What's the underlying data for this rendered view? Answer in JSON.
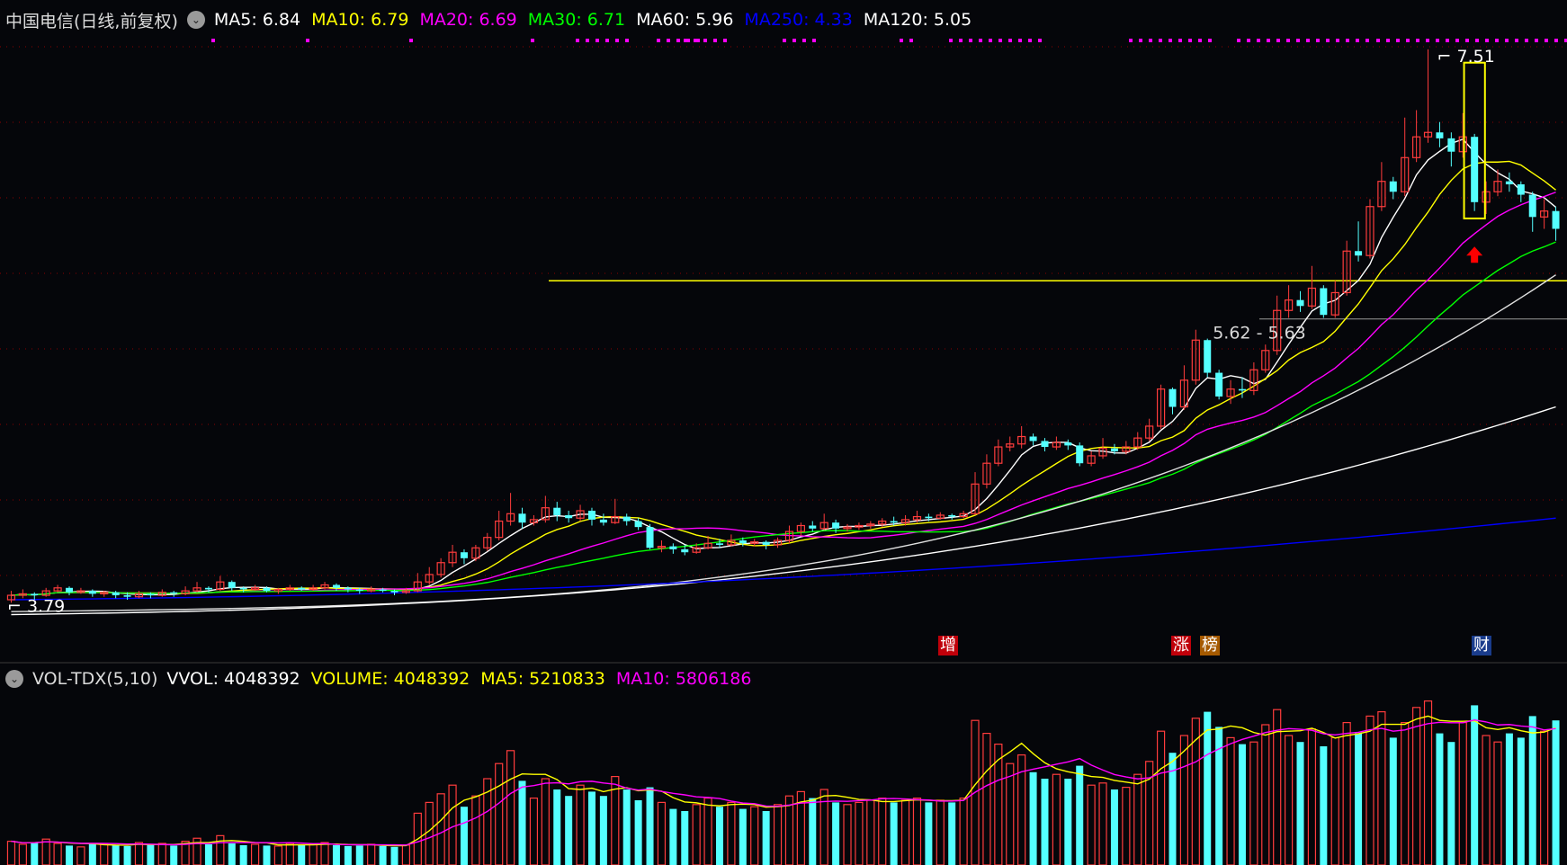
{
  "header": {
    "title": "中国电信(日线,前复权)",
    "ma": [
      {
        "label": "MA5: 6.84",
        "color": "#ffffff"
      },
      {
        "label": "MA10: 6.79",
        "color": "#ffff00"
      },
      {
        "label": "MA20: 6.69",
        "color": "#ff00ff"
      },
      {
        "label": "MA30: 6.71",
        "color": "#00ff00"
      },
      {
        "label": "MA60: 5.96",
        "color": "#ffffff"
      },
      {
        "label": "MA250: 4.33",
        "color": "#0000ff"
      },
      {
        "label": "MA120: 5.05",
        "color": "#ffffff"
      }
    ]
  },
  "volume_header": {
    "title": "VOL-TDX(5,10)",
    "items": [
      {
        "label": "VVOL: 4048392",
        "color": "#ffffff"
      },
      {
        "label": "VOLUME: 4048392",
        "color": "#ffff00"
      },
      {
        "label": "MA5: 5210833",
        "color": "#ffff00"
      },
      {
        "label": "MA10: 5806186",
        "color": "#ff00ff"
      }
    ]
  },
  "annotations": {
    "high_label": "7.51",
    "low_label": "3.79",
    "gap_label": "5.62 - 5.63",
    "event_tags": [
      {
        "text": "增",
        "bg": "#c0000a"
      },
      {
        "text": "涨",
        "bg": "#c0000a"
      },
      {
        "text": "榜",
        "bg": "#a65a00"
      },
      {
        "text": "财",
        "bg": "#1a3c8c"
      }
    ]
  },
  "colors": {
    "up": "#ff3c3c",
    "down": "#54ffff",
    "background": "#05060a",
    "grid": "#8a0000",
    "ma5": "#ffffff",
    "ma10": "#ffff00",
    "ma20": "#ff00ff",
    "ma30": "#00ff00",
    "ma60": "#e0e0e0",
    "ma120": "#ffffff",
    "ma250": "#0000ff",
    "support_line": "#ffff00",
    "highlight_box": "#ffff00",
    "arrow": "#ff0000",
    "dots": "#ff00ff"
  },
  "chart_data": {
    "type": "candlestick",
    "ylim": [
      3.6,
      7.6
    ],
    "support_level": 5.95,
    "gap_level": 5.62,
    "candles": [
      [
        3.8,
        3.83,
        3.86,
        3.78
      ],
      [
        3.83,
        3.84,
        3.87,
        3.81
      ],
      [
        3.84,
        3.83,
        3.85,
        3.8
      ],
      [
        3.83,
        3.86,
        3.88,
        3.82
      ],
      [
        3.86,
        3.88,
        3.9,
        3.85
      ],
      [
        3.88,
        3.85,
        3.89,
        3.83
      ],
      [
        3.85,
        3.86,
        3.88,
        3.84
      ],
      [
        3.86,
        3.84,
        3.87,
        3.82
      ],
      [
        3.84,
        3.85,
        3.86,
        3.82
      ],
      [
        3.85,
        3.83,
        3.86,
        3.81
      ],
      [
        3.83,
        3.82,
        3.85,
        3.8
      ],
      [
        3.82,
        3.84,
        3.86,
        3.81
      ],
      [
        3.84,
        3.83,
        3.85,
        3.81
      ],
      [
        3.83,
        3.85,
        3.87,
        3.82
      ],
      [
        3.85,
        3.84,
        3.86,
        3.82
      ],
      [
        3.84,
        3.86,
        3.89,
        3.83
      ],
      [
        3.86,
        3.88,
        3.92,
        3.85
      ],
      [
        3.88,
        3.87,
        3.89,
        3.85
      ],
      [
        3.87,
        3.92,
        3.96,
        3.86
      ],
      [
        3.92,
        3.88,
        3.93,
        3.86
      ],
      [
        3.88,
        3.87,
        3.89,
        3.85
      ],
      [
        3.87,
        3.88,
        3.9,
        3.86
      ],
      [
        3.88,
        3.86,
        3.89,
        3.85
      ],
      [
        3.86,
        3.87,
        3.88,
        3.84
      ],
      [
        3.87,
        3.88,
        3.9,
        3.86
      ],
      [
        3.88,
        3.87,
        3.89,
        3.86
      ],
      [
        3.87,
        3.88,
        3.9,
        3.86
      ],
      [
        3.88,
        3.9,
        3.92,
        3.87
      ],
      [
        3.9,
        3.88,
        3.91,
        3.86
      ],
      [
        3.88,
        3.87,
        3.89,
        3.85
      ],
      [
        3.87,
        3.86,
        3.88,
        3.84
      ],
      [
        3.86,
        3.87,
        3.89,
        3.85
      ],
      [
        3.87,
        3.86,
        3.88,
        3.85
      ],
      [
        3.86,
        3.85,
        3.87,
        3.83
      ],
      [
        3.85,
        3.86,
        3.88,
        3.84
      ],
      [
        3.86,
        3.92,
        3.98,
        3.85
      ],
      [
        3.92,
        3.97,
        4.02,
        3.9
      ],
      [
        3.97,
        4.05,
        4.08,
        3.95
      ],
      [
        4.05,
        4.12,
        4.17,
        4.02
      ],
      [
        4.12,
        4.08,
        4.14,
        4.04
      ],
      [
        4.08,
        4.15,
        4.17,
        4.06
      ],
      [
        4.15,
        4.22,
        4.25,
        4.13
      ],
      [
        4.22,
        4.33,
        4.4,
        4.2
      ],
      [
        4.33,
        4.38,
        4.52,
        4.3
      ],
      [
        4.38,
        4.32,
        4.42,
        4.28
      ],
      [
        4.32,
        4.34,
        4.37,
        4.3
      ],
      [
        4.34,
        4.42,
        4.5,
        4.32
      ],
      [
        4.42,
        4.37,
        4.46,
        4.33
      ],
      [
        4.37,
        4.35,
        4.4,
        4.32
      ],
      [
        4.35,
        4.4,
        4.44,
        4.33
      ],
      [
        4.4,
        4.34,
        4.42,
        4.3
      ],
      [
        4.34,
        4.32,
        4.38,
        4.3
      ],
      [
        4.32,
        4.36,
        4.48,
        4.31
      ],
      [
        4.36,
        4.33,
        4.38,
        4.3
      ],
      [
        4.33,
        4.29,
        4.35,
        4.27
      ],
      [
        4.29,
        4.15,
        4.31,
        4.14
      ],
      [
        4.15,
        4.16,
        4.2,
        4.12
      ],
      [
        4.16,
        4.14,
        4.18,
        4.11
      ],
      [
        4.14,
        4.12,
        4.17,
        4.1
      ],
      [
        4.12,
        4.15,
        4.18,
        4.11
      ],
      [
        4.15,
        4.18,
        4.23,
        4.14
      ],
      [
        4.18,
        4.17,
        4.21,
        4.15
      ],
      [
        4.17,
        4.2,
        4.24,
        4.16
      ],
      [
        4.2,
        4.18,
        4.22,
        4.16
      ],
      [
        4.18,
        4.19,
        4.21,
        4.16
      ],
      [
        4.19,
        4.17,
        4.2,
        4.14
      ],
      [
        4.17,
        4.2,
        4.22,
        4.15
      ],
      [
        4.2,
        4.26,
        4.3,
        4.18
      ],
      [
        4.26,
        4.3,
        4.32,
        4.23
      ],
      [
        4.3,
        4.28,
        4.33,
        4.26
      ],
      [
        4.28,
        4.32,
        4.38,
        4.27
      ],
      [
        4.32,
        4.28,
        4.34,
        4.25
      ],
      [
        4.28,
        4.29,
        4.31,
        4.26
      ],
      [
        4.29,
        4.3,
        4.32,
        4.27
      ],
      [
        4.3,
        4.31,
        4.33,
        4.28
      ],
      [
        4.31,
        4.33,
        4.35,
        4.29
      ],
      [
        4.33,
        4.32,
        4.36,
        4.3
      ],
      [
        4.32,
        4.34,
        4.37,
        4.3
      ],
      [
        4.34,
        4.36,
        4.4,
        4.32
      ],
      [
        4.36,
        4.35,
        4.38,
        4.33
      ],
      [
        4.35,
        4.37,
        4.39,
        4.34
      ],
      [
        4.37,
        4.36,
        4.38,
        4.34
      ],
      [
        4.36,
        4.38,
        4.4,
        4.35
      ],
      [
        4.38,
        4.58,
        4.66,
        4.37
      ],
      [
        4.58,
        4.72,
        4.78,
        4.55
      ],
      [
        4.72,
        4.83,
        4.88,
        4.7
      ],
      [
        4.83,
        4.85,
        4.9,
        4.8
      ],
      [
        4.85,
        4.9,
        4.97,
        4.82
      ],
      [
        4.9,
        4.87,
        4.92,
        4.84
      ],
      [
        4.87,
        4.83,
        4.89,
        4.8
      ],
      [
        4.83,
        4.86,
        4.9,
        4.81
      ],
      [
        4.86,
        4.84,
        4.88,
        4.81
      ],
      [
        4.84,
        4.72,
        4.86,
        4.7
      ],
      [
        4.72,
        4.77,
        4.8,
        4.7
      ],
      [
        4.77,
        4.82,
        4.89,
        4.75
      ],
      [
        4.82,
        4.8,
        4.85,
        4.78
      ],
      [
        4.8,
        4.83,
        4.87,
        4.78
      ],
      [
        4.83,
        4.89,
        4.93,
        4.81
      ],
      [
        4.89,
        4.97,
        5.02,
        4.87
      ],
      [
        4.97,
        5.22,
        5.25,
        4.95
      ],
      [
        5.22,
        5.1,
        5.23,
        5.05
      ],
      [
        5.1,
        5.28,
        5.38,
        5.08
      ],
      [
        5.28,
        5.55,
        5.62,
        5.25
      ],
      [
        5.55,
        5.33,
        5.56,
        5.3
      ],
      [
        5.33,
        5.17,
        5.35,
        5.15
      ],
      [
        5.17,
        5.22,
        5.28,
        5.12
      ],
      [
        5.22,
        5.21,
        5.3,
        5.16
      ],
      [
        5.21,
        5.35,
        5.4,
        5.18
      ],
      [
        5.35,
        5.48,
        5.52,
        5.33
      ],
      [
        5.48,
        5.75,
        5.85,
        5.45
      ],
      [
        5.75,
        5.82,
        5.92,
        5.7
      ],
      [
        5.82,
        5.78,
        5.88,
        5.74
      ],
      [
        5.78,
        5.9,
        6.05,
        5.76
      ],
      [
        5.9,
        5.72,
        5.92,
        5.7
      ],
      [
        5.72,
        5.87,
        5.95,
        5.7
      ],
      [
        5.87,
        6.15,
        6.22,
        5.85
      ],
      [
        6.15,
        6.12,
        6.35,
        6.08
      ],
      [
        6.12,
        6.45,
        6.5,
        6.1
      ],
      [
        6.45,
        6.62,
        6.75,
        6.42
      ],
      [
        6.62,
        6.55,
        6.65,
        6.5
      ],
      [
        6.55,
        6.78,
        7.05,
        6.52
      ],
      [
        6.78,
        6.92,
        7.1,
        6.75
      ],
      [
        6.92,
        6.95,
        7.51,
        6.88
      ],
      [
        6.95,
        6.91,
        7.02,
        6.85
      ],
      [
        6.91,
        6.82,
        6.95,
        6.72
      ],
      [
        6.82,
        6.92,
        7.08,
        6.78
      ],
      [
        6.92,
        6.48,
        6.94,
        6.42
      ],
      [
        6.48,
        6.55,
        6.62,
        6.4
      ],
      [
        6.55,
        6.62,
        6.7,
        6.52
      ],
      [
        6.62,
        6.6,
        6.68,
        6.55
      ],
      [
        6.6,
        6.53,
        6.62,
        6.48
      ],
      [
        6.53,
        6.38,
        6.55,
        6.28
      ],
      [
        6.38,
        6.42,
        6.5,
        6.3
      ],
      [
        6.42,
        6.3,
        6.45,
        6.22
      ]
    ],
    "volume": [
      0.55,
      0.48,
      0.52,
      0.6,
      0.5,
      0.45,
      0.42,
      0.5,
      0.48,
      0.46,
      0.44,
      0.52,
      0.47,
      0.5,
      0.45,
      0.55,
      0.62,
      0.48,
      0.68,
      0.5,
      0.46,
      0.48,
      0.45,
      0.44,
      0.5,
      0.47,
      0.48,
      0.52,
      0.46,
      0.44,
      0.45,
      0.48,
      0.44,
      0.42,
      0.46,
      1.2,
      1.45,
      1.65,
      1.85,
      1.35,
      1.6,
      2.0,
      2.35,
      2.65,
      1.95,
      1.55,
      2.0,
      1.75,
      1.6,
      1.85,
      1.7,
      1.6,
      2.05,
      1.75,
      1.5,
      1.8,
      1.45,
      1.3,
      1.25,
      1.4,
      1.55,
      1.35,
      1.45,
      1.3,
      1.35,
      1.25,
      1.4,
      1.6,
      1.7,
      1.55,
      1.75,
      1.45,
      1.4,
      1.45,
      1.5,
      1.55,
      1.45,
      1.5,
      1.55,
      1.45,
      1.5,
      1.45,
      1.55,
      3.35,
      3.05,
      2.8,
      2.35,
      2.55,
      2.15,
      2.0,
      2.1,
      2.0,
      2.3,
      1.85,
      1.9,
      1.75,
      1.8,
      2.1,
      2.4,
      3.1,
      2.6,
      3.0,
      3.4,
      3.55,
      3.2,
      2.95,
      2.8,
      2.85,
      3.25,
      3.6,
      3.0,
      2.85,
      3.15,
      2.75,
      2.95,
      3.3,
      3.05,
      3.45,
      3.55,
      2.95,
      3.3,
      3.65,
      3.8,
      3.05,
      2.85,
      3.3,
      3.7,
      3.0,
      2.85,
      3.05,
      2.95,
      3.45,
      3.1,
      3.35
    ],
    "volume_ylim": [
      0,
      4.0
    ]
  }
}
